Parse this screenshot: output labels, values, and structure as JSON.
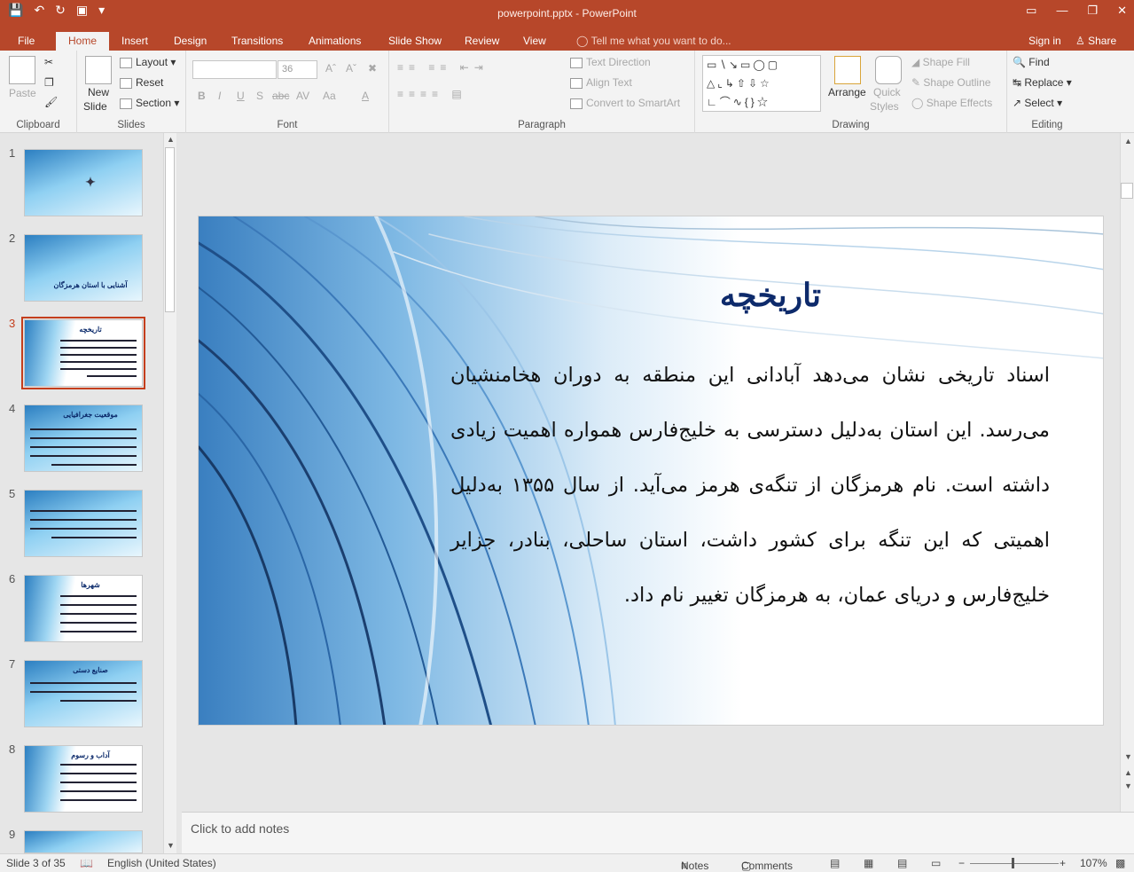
{
  "window": {
    "title": "powerpoint.pptx - PowerPoint"
  },
  "tabs": [
    "File",
    "Home",
    "Insert",
    "Design",
    "Transitions",
    "Animations",
    "Slide Show",
    "Review",
    "View"
  ],
  "active_tab": "Home",
  "tell_me": "Tell me what you want to do...",
  "account": {
    "signin": "Sign in",
    "share": "Share"
  },
  "ribbon": {
    "clipboard": {
      "label": "Clipboard",
      "paste": "Paste"
    },
    "slides": {
      "label": "Slides",
      "new_slide_1": "New",
      "new_slide_2": "Slide",
      "layout": "Layout",
      "reset": "Reset",
      "section": "Section"
    },
    "font": {
      "label": "Font",
      "size": "36",
      "bold": "B",
      "italic": "I",
      "underline": "U",
      "shadow": "S",
      "strike": "abc",
      "spacing": "AV",
      "case": "Aa",
      "color": "A"
    },
    "paragraph": {
      "label": "Paragraph",
      "text_direction": "Text Direction",
      "align_text": "Align Text",
      "smartart": "Convert to SmartArt"
    },
    "drawing": {
      "label": "Drawing",
      "arrange": "Arrange",
      "quick_1": "Quick",
      "quick_2": "Styles",
      "shape_fill": "Shape Fill",
      "shape_outline": "Shape Outline",
      "shape_effects": "Shape Effects"
    },
    "editing": {
      "label": "Editing",
      "find": "Find",
      "replace": "Replace",
      "select": "Select"
    }
  },
  "thumbnails": [
    {
      "num": "1",
      "title": ""
    },
    {
      "num": "2",
      "title": "آشنایی با استان هرمزگان"
    },
    {
      "num": "3",
      "title": "تاریخچه"
    },
    {
      "num": "4",
      "title": "موقعیت جغرافیایی"
    },
    {
      "num": "5",
      "title": ""
    },
    {
      "num": "6",
      "title": "شهرها"
    },
    {
      "num": "7",
      "title": "صنایع دستی"
    },
    {
      "num": "8",
      "title": "آداب و رسوم"
    },
    {
      "num": "9",
      "title": ""
    }
  ],
  "slide": {
    "title": "تاریخچه",
    "body": "اسناد تاریخی نشان می‌دهد آبادانی این منطقه به دوران هخامنشیان می‌رسد. این استان به‌دلیل دسترسی به خلیج‌فارس همواره اهمیت زیادی داشته است. نام هرمزگان از تنگه‌ی هرمز می‌آید. از سال ۱۳۵۵ به‌دلیل اهمیتی که این تنگه برای کشور داشت، استان ساحلی، بنادر، جزایر خلیج‌فارس و دریای عمان، به هرمزگان تغییر نام داد."
  },
  "notes": {
    "placeholder": "Click to add notes"
  },
  "status": {
    "slide_info": "Slide 3 of 35",
    "language": "English (United States)",
    "notes": "Notes",
    "comments": "Comments",
    "zoom": "107%"
  }
}
